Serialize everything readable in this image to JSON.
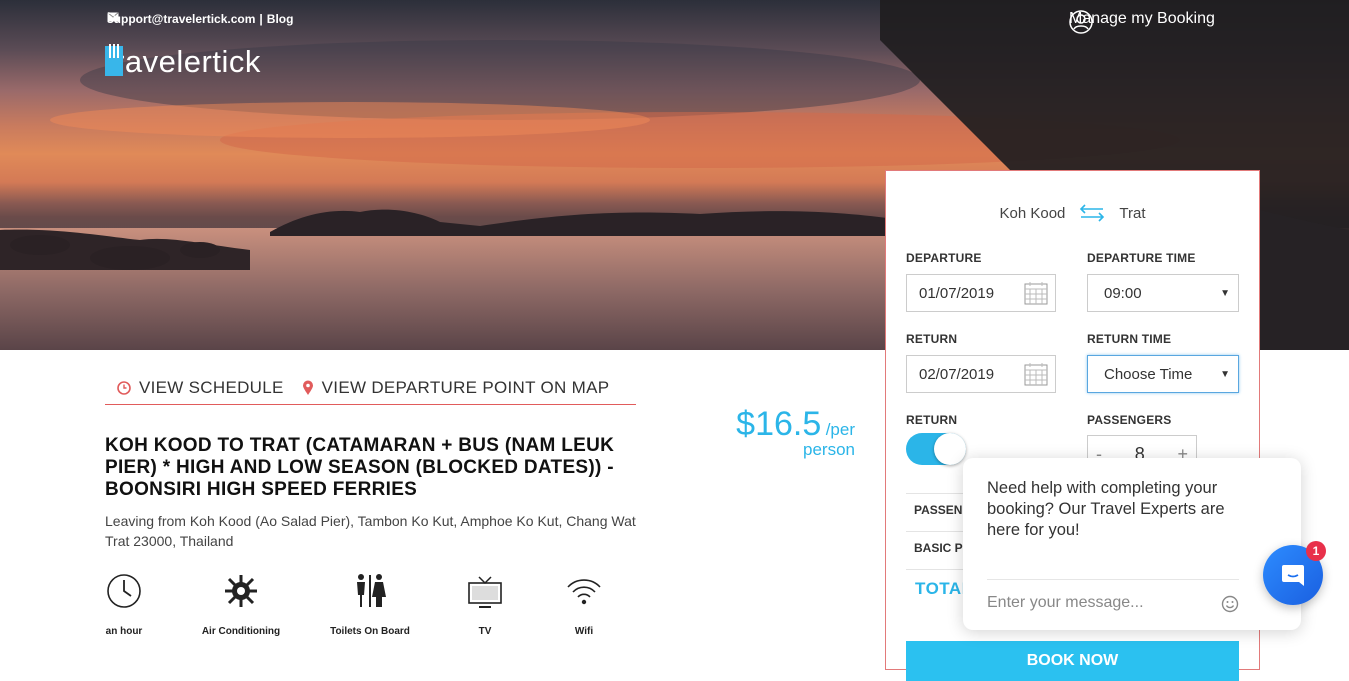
{
  "header": {
    "email": "support@travelertick.com",
    "separator": "|",
    "blog": "Blog",
    "logo_text": "travelertick",
    "manage_booking": "Manage my Booking"
  },
  "tabs": [
    {
      "label": "VIEW SCHEDULE",
      "icon": "clock-icon"
    },
    {
      "label": "VIEW DEPARTURE POINT ON MAP",
      "icon": "map-pin-icon"
    }
  ],
  "trip": {
    "title": "KOH KOOD TO TRAT (CATAMARAN + BUS (NAM LEUK PIER) * HIGH AND LOW SEASON (BLOCKED DATES)) - BOONSIRI HIGH SPEED FERRIES",
    "address": "Leaving from Koh Kood (Ao Salad Pier), Tambon Ko Kut, Amphoe Ko Kut, Chang Wat Trat 23000, Thailand",
    "price": "$16.5",
    "per": "/per",
    "person": "person"
  },
  "amenities": [
    {
      "label": "an hour",
      "icon": "clock-icon"
    },
    {
      "label": "Air Conditioning",
      "icon": "snowflake-icon"
    },
    {
      "label": "Toilets On Board",
      "icon": "restroom-icon"
    },
    {
      "label": "TV",
      "icon": "tv-icon"
    },
    {
      "label": "Wifi",
      "icon": "wifi-icon"
    }
  ],
  "booking": {
    "from": "Koh Kood",
    "to": "Trat",
    "departure_label": "DEPARTURE",
    "departure_value": "01/07/2019",
    "departure_time_label": "DEPARTURE TIME",
    "departure_time_value": "09:00",
    "return_label": "RETURN",
    "return_value": "02/07/2019",
    "return_time_label": "RETURN TIME",
    "return_time_value": "Choose Time",
    "return_toggle_label": "RETURN",
    "return_toggle_on": true,
    "passengers_label": "PASSENGERS",
    "passengers_value": "8",
    "minus": "-",
    "plus": "+",
    "passengers_row": "PASSEN",
    "basic_row": "BASIC P",
    "total": "TOTAL",
    "book_now": "BOOK NOW"
  },
  "chat": {
    "message": "Need help with completing your booking? Our Travel Experts are here for you!",
    "placeholder": "Enter your message...",
    "badge": "1"
  },
  "colors": {
    "accent": "#2bb5e8",
    "tab_underline": "#e15b5b",
    "panel_border": "#e27a7a",
    "chat_button": "#1a6ff0",
    "badge": "#e8304a"
  }
}
